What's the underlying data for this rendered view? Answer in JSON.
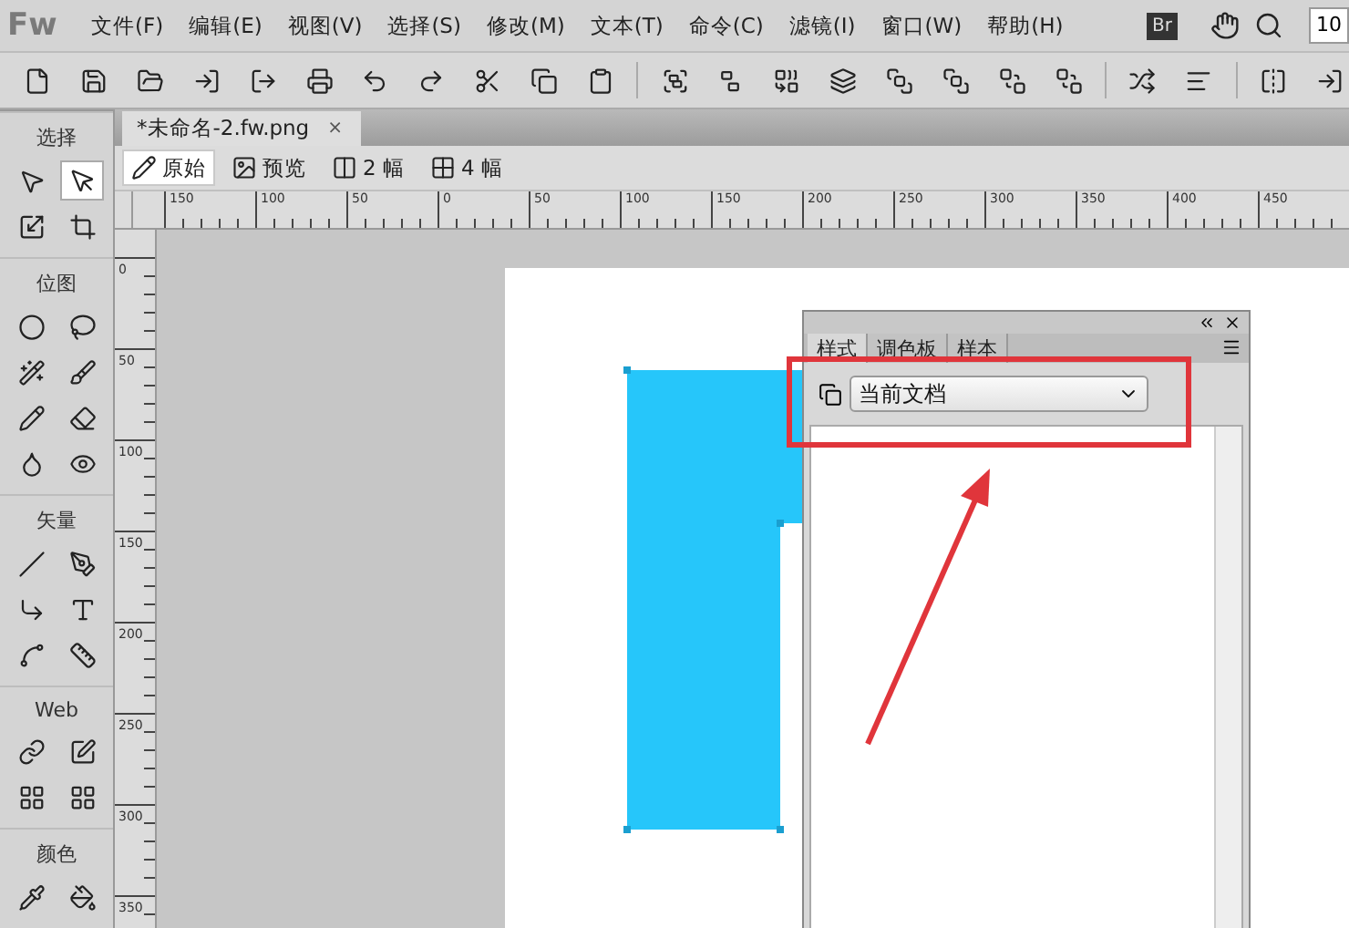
{
  "app_logo": "Fw",
  "menu": [
    "文件(F)",
    "编辑(E)",
    "视图(V)",
    "选择(S)",
    "修改(M)",
    "文本(T)",
    "命令(C)",
    "滤镜(I)",
    "窗口(W)",
    "帮助(H)"
  ],
  "bridge_badge": "Br",
  "zoom_field": "10",
  "document_tab": {
    "title": "*未命名-2.fw.png",
    "close": "×",
    "selected": true
  },
  "view_modes": [
    {
      "label": "原始",
      "selected": true
    },
    {
      "label": "预览",
      "selected": false
    },
    {
      "label": "2 幅",
      "selected": false
    },
    {
      "label": "4 幅",
      "selected": false
    }
  ],
  "tool_sections": [
    {
      "title": "选择",
      "kind": "select"
    },
    {
      "title": "位图",
      "kind": "bitmap"
    },
    {
      "title": "矢量",
      "kind": "vector"
    },
    {
      "title": "Web",
      "kind": "web"
    },
    {
      "title": "颜色",
      "kind": "color"
    }
  ],
  "ruler": {
    "x_labels": [
      "150",
      "100",
      "50",
      "0",
      "50",
      "100",
      "150",
      "200",
      "250",
      "300",
      "350",
      "400",
      "450"
    ],
    "y_labels": [
      "0",
      "50",
      "100",
      "150",
      "200",
      "250",
      "300",
      "350"
    ]
  },
  "panel": {
    "tabs": [
      {
        "label": "样式",
        "selected": true
      },
      {
        "label": "调色板",
        "selected": false
      },
      {
        "label": "样本",
        "selected": false
      }
    ],
    "source_dropdown": "当前文档"
  }
}
